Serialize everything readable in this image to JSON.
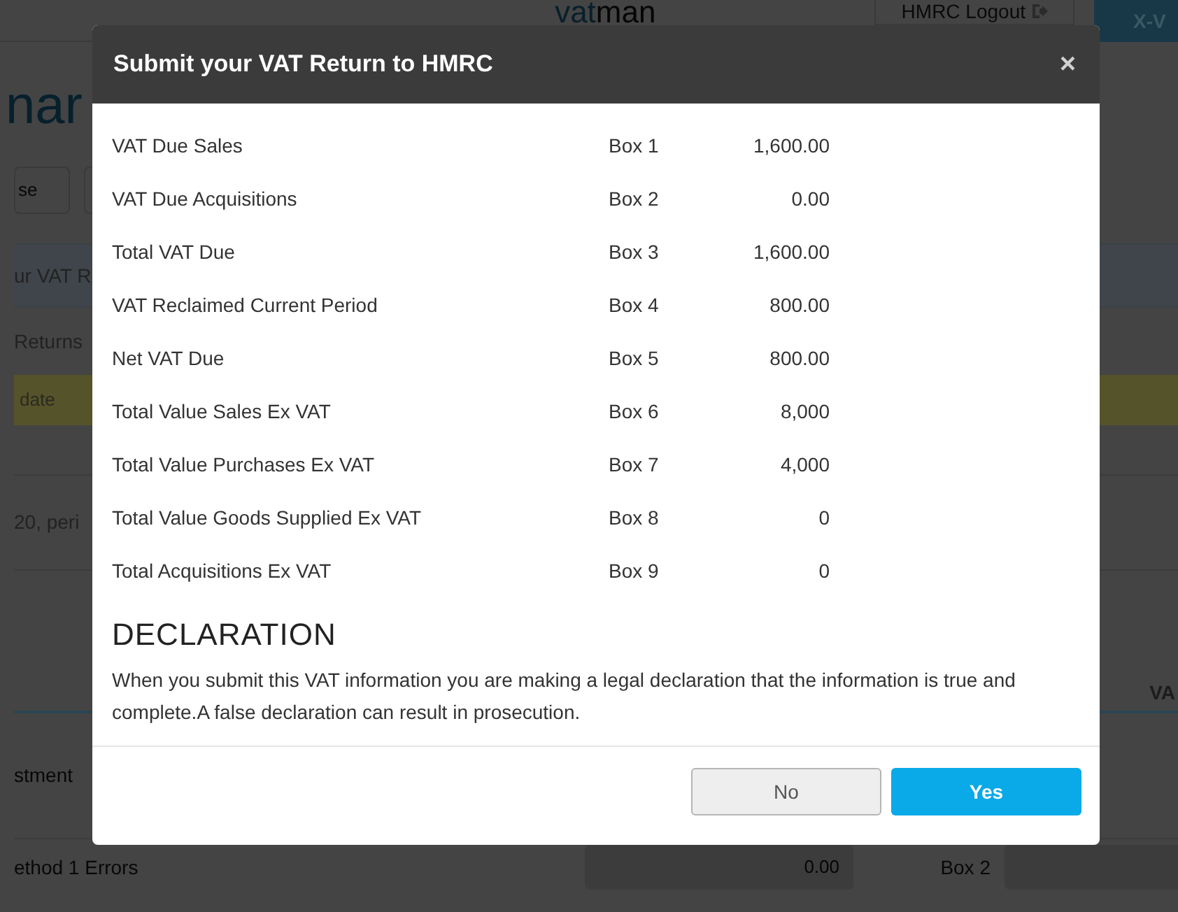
{
  "background": {
    "logo": {
      "first": "vat",
      "second": "man"
    },
    "logout_button": "HMRC Logout",
    "user_button": "X-V",
    "page_title": "nar",
    "action_button": "se",
    "panel_heading": "ur VAT R",
    "section_label": "Returns",
    "table_header": "date",
    "row_text": "20, peri",
    "column_heading": "VA",
    "rows": [
      {
        "label": "stment"
      },
      {
        "label": "ethod 1 Errors",
        "value": "0.00",
        "box": "Box 2"
      }
    ]
  },
  "modal": {
    "title": "Submit your VAT Return to HMRC",
    "close": "×",
    "rows": [
      {
        "label": "VAT Due Sales",
        "box": "Box 1",
        "value": "1,600.00"
      },
      {
        "label": "VAT Due Acquisitions",
        "box": "Box 2",
        "value": "0.00"
      },
      {
        "label": "Total VAT Due",
        "box": "Box 3",
        "value": "1,600.00"
      },
      {
        "label": "VAT Reclaimed Current Period",
        "box": "Box 4",
        "value": "800.00"
      },
      {
        "label": "Net VAT Due",
        "box": "Box 5",
        "value": "800.00"
      },
      {
        "label": "Total Value Sales Ex VAT",
        "box": "Box 6",
        "value": "8,000"
      },
      {
        "label": "Total Value Purchases Ex VAT",
        "box": "Box 7",
        "value": "4,000"
      },
      {
        "label": "Total Value Goods Supplied Ex VAT",
        "box": "Box 8",
        "value": "0"
      },
      {
        "label": "Total Acquisitions Ex VAT",
        "box": "Box 9",
        "value": "0"
      }
    ],
    "declaration": {
      "heading": "DECLARATION",
      "text": "When you submit this VAT information you are making a legal declaration that the information is true and complete.A false declaration can result in prosecution."
    },
    "buttons": [
      {
        "label": "No",
        "kind": "secondary"
      },
      {
        "label": "Yes",
        "kind": "primary"
      }
    ]
  }
}
